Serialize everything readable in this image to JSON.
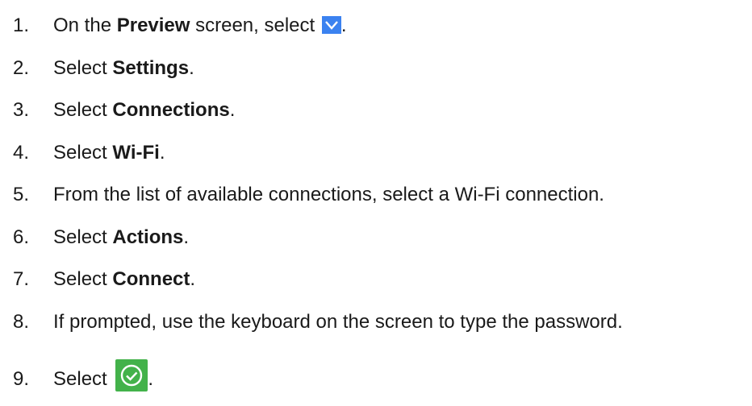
{
  "steps": [
    {
      "num": "1.",
      "pre": "On the ",
      "bold": "Preview",
      "post": " screen, select ",
      "icon": "chevron-down-icon",
      "end": "."
    },
    {
      "num": "2.",
      "pre": "Select ",
      "bold": "Settings",
      "post": "."
    },
    {
      "num": "3.",
      "pre": "Select ",
      "bold": "Connections",
      "post": "."
    },
    {
      "num": "4.",
      "pre": "Select ",
      "bold": "Wi-Fi",
      "post": "."
    },
    {
      "num": "5.",
      "text": "From the list of available connections, select a Wi-Fi connection."
    },
    {
      "num": "6.",
      "pre": "Select ",
      "bold": "Actions",
      "post": "."
    },
    {
      "num": "7.",
      "pre": "Select ",
      "bold": "Connect",
      "post": "."
    },
    {
      "num": "8.",
      "text": "If prompted, use the keyboard on the screen to type the password."
    },
    {
      "num": "9.",
      "pre": "Select ",
      "icon": "check-circle-icon",
      "end": "."
    }
  ],
  "colors": {
    "chevron_bg": "#3b82f0",
    "check_bg": "#43b24a",
    "text": "#1a1a1a"
  }
}
